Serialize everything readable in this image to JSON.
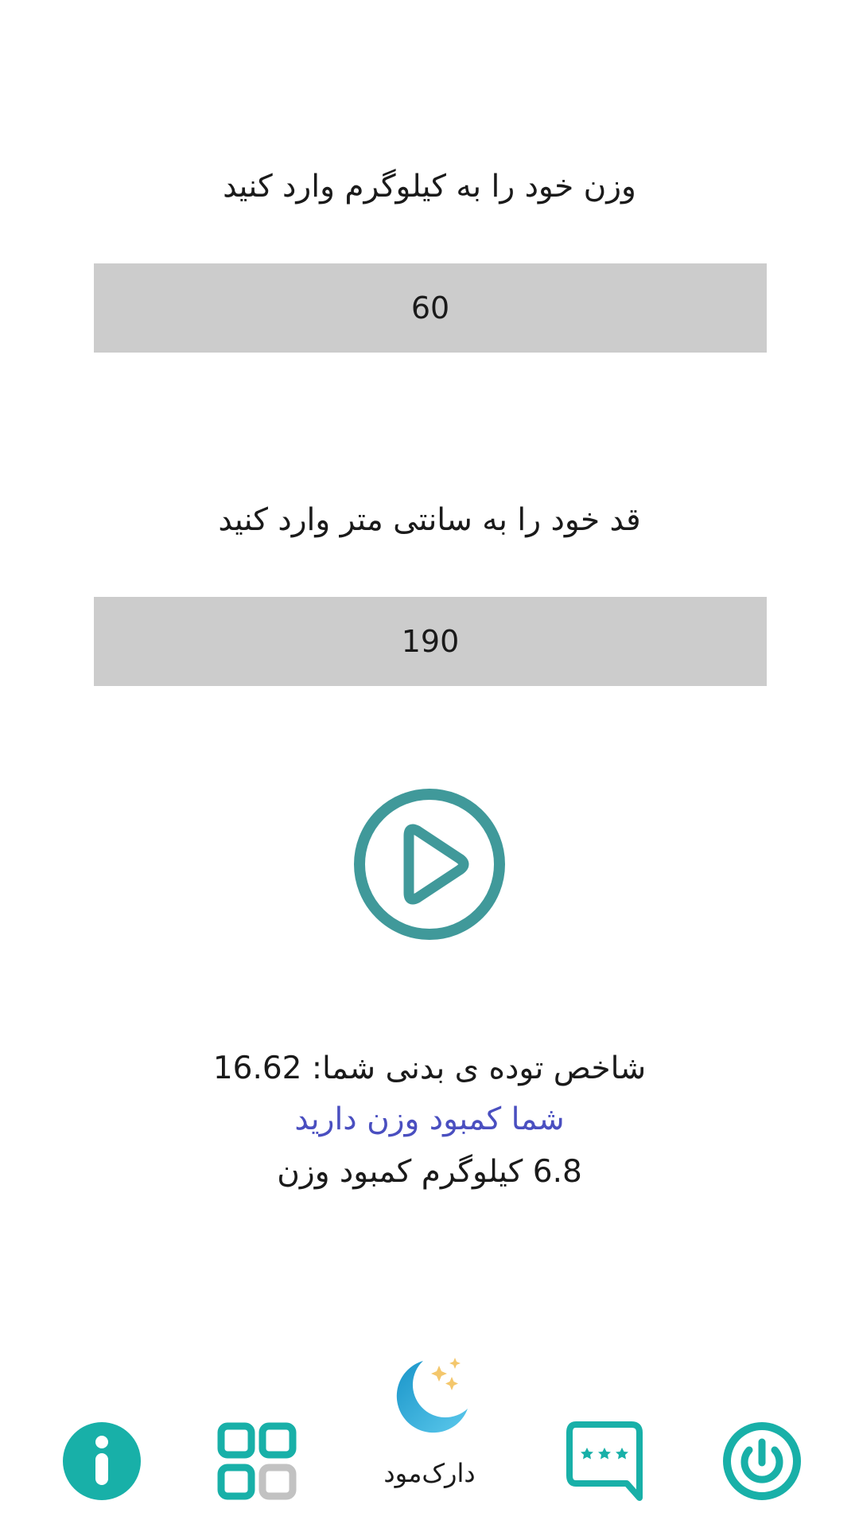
{
  "weight": {
    "label": "وزن خود را به کیلوگرم وارد کنید",
    "value": "60"
  },
  "height": {
    "label": "قد خود را به سانتی متر وارد کنید",
    "value": "190"
  },
  "calculate_button": {
    "icon": "play-circle-icon",
    "color": "#40999a"
  },
  "result": {
    "bmi_line": "شاخص توده ی بدنی شما: 16.62",
    "status": "شما کمبود وزن دارید",
    "status_color": "#4a4fc0",
    "deficit": "6.8 کیلوگرم کمبود وزن"
  },
  "bottom_nav": {
    "accent_color": "#18b0a8",
    "items": [
      {
        "icon": "info-icon"
      },
      {
        "icon": "grid-apps-icon"
      },
      {
        "icon": "moon-stars-icon",
        "label": "دارک‌مود"
      },
      {
        "icon": "rating-message-icon"
      },
      {
        "icon": "power-icon"
      }
    ]
  }
}
